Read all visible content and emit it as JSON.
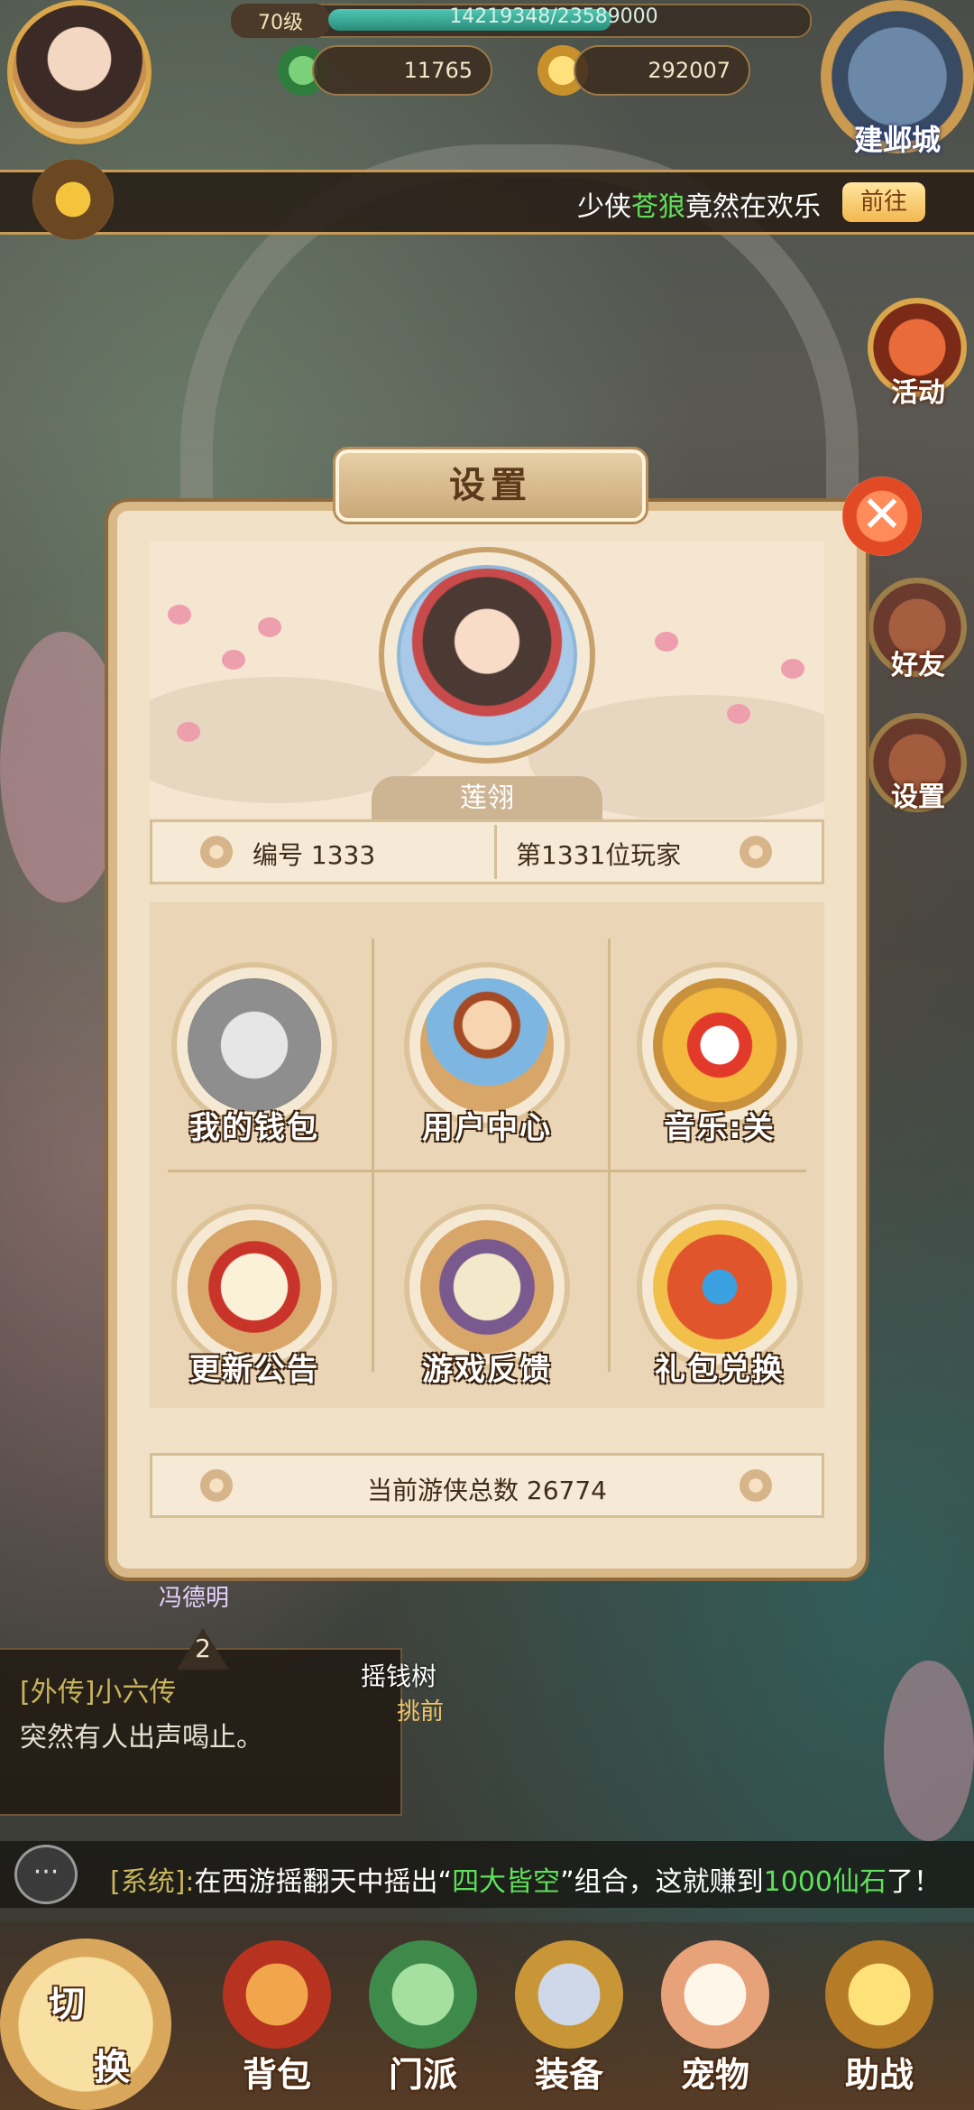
{
  "hud": {
    "level": "70级",
    "exp_text": "14219348/23589000",
    "exp_progress": 0.603,
    "jade": "11765",
    "gold": "292007",
    "build_city": "建邺城"
  },
  "marquee": {
    "prefix": "少侠",
    "highlight": "苍狼",
    "suffix": "竟然在欢乐",
    "goto": "前往"
  },
  "side": {
    "activity": "活动",
    "friends": "好友",
    "settings": "设置"
  },
  "dialog": {
    "title": "设置",
    "player_name": "莲翎",
    "id_text": "编号 1333",
    "rank_text": "第1331位玩家",
    "buttons": [
      {
        "label": "我的钱包",
        "icon": "money-bag-icon"
      },
      {
        "label": "用户中心",
        "icon": "user-figure-icon"
      },
      {
        "label": "音乐:关",
        "icon": "music-off-icon"
      },
      {
        "label": "更新公告",
        "icon": "scroll-icon"
      },
      {
        "label": "游戏反馈",
        "icon": "book-quill-icon"
      },
      {
        "label": "礼包兑换",
        "icon": "gift-bag-icon"
      }
    ],
    "total_text": "当前游侠总数 26774"
  },
  "story": {
    "badge": "2",
    "tag": "[外传]小六传",
    "line": "突然有人出声喝止。"
  },
  "npcs": {
    "n1": "冯德明",
    "n2": "摇钱树",
    "n3": "挑前"
  },
  "chat": {
    "icon": "speech-bubble-icon",
    "sys": "[系统]:",
    "part1": "在西游摇翻天中摇出“",
    "hl1": "四大皆空",
    "part2": "”组合，这就赚到",
    "hl2": "1000仙石",
    "part3": "了！"
  },
  "nav": {
    "switch": [
      "切",
      "换"
    ],
    "items": [
      "背包",
      "门派",
      "装备",
      "宠物",
      "助战"
    ]
  },
  "colors": {
    "accent_gold": "#d9a64b",
    "close_red": "#e24a25",
    "highlight_green": "#5ee05a"
  }
}
